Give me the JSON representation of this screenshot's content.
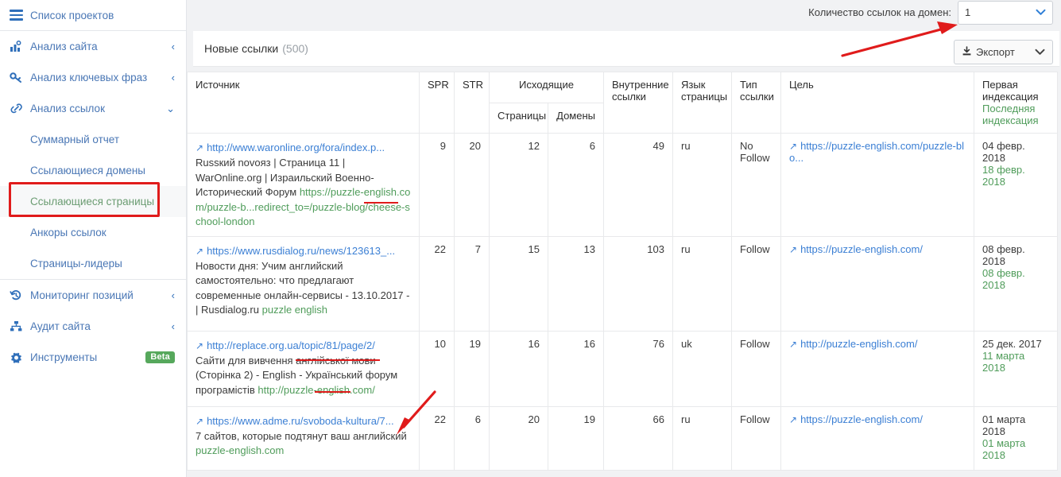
{
  "sidebar": {
    "header": {
      "label": "Список проектов",
      "icon": "hamburger-icon"
    },
    "items": [
      {
        "label": "Анализ сайта",
        "icon": "site-analysis-icon",
        "chevron": "‹"
      },
      {
        "label": "Анализ ключевых фраз",
        "icon": "key-icon",
        "chevron": "‹"
      },
      {
        "label": "Анализ ссылок",
        "icon": "link-icon",
        "chevron": "⌄"
      }
    ],
    "sub_items": [
      {
        "label": "Суммарный отчет",
        "active": false
      },
      {
        "label": "Ссылающиеся домены",
        "active": false
      },
      {
        "label": "Ссылающиеся страницы",
        "active": true
      },
      {
        "label": "Анкоры ссылок",
        "active": false
      },
      {
        "label": "Страницы-лидеры",
        "active": false
      }
    ],
    "bottom_items": [
      {
        "label": "Мониторинг позиций",
        "icon": "history-icon",
        "chevron": "‹",
        "badge": ""
      },
      {
        "label": "Аудит сайта",
        "icon": "sitemap-icon",
        "chevron": "‹",
        "badge": ""
      },
      {
        "label": "Инструменты",
        "icon": "gear-icon",
        "chevron": "",
        "badge": "Beta"
      }
    ]
  },
  "topbar": {
    "links_per_domain_label": "Количество ссылок на домен:",
    "links_per_domain_value": "1",
    "export_label": "Экспорт",
    "export_icon": "download-icon",
    "caret_icon": "chevron-down-icon"
  },
  "panel": {
    "title": "Новые ссылки",
    "count": "(500)"
  },
  "table": {
    "columns": [
      {
        "key": "source",
        "label": "Источник"
      },
      {
        "key": "spr",
        "label": "SPR"
      },
      {
        "key": "str",
        "label": "STR"
      },
      {
        "key": "outgoing",
        "label": "Исходящие",
        "sub": [
          "Страницы",
          "Домены"
        ]
      },
      {
        "key": "internal",
        "label": "Внутренние ссылки"
      },
      {
        "key": "lang",
        "label": "Язык страницы"
      },
      {
        "key": "linktype",
        "label": "Тип ссылки"
      },
      {
        "key": "target",
        "label": "Цель"
      },
      {
        "key": "indexation",
        "label_first": "Первая индексация",
        "label_last": "Последняя индексация"
      }
    ],
    "rows": [
      {
        "source_url": "http://www.waronline.org/fora/index.p...",
        "source_desc": "Russкий novoяз | Страница 11 | WarOnline.org | Израильский Военно-Исторический Форум",
        "source_extra": "https://puzzle-english.com/puzzle-b...redirect_to=/puzzle-blog/cheese-school-london",
        "spr": "9",
        "str": "20",
        "out_pages": "12",
        "out_domains": "6",
        "internal": "49",
        "lang": "ru",
        "linktype": "No Follow",
        "target": "https://puzzle-english.com/puzzle-blo...",
        "first_index": "04 февр. 2018",
        "last_index": "18 февр. 2018"
      },
      {
        "source_url": "https://www.rusdialog.ru/news/123613_...",
        "source_desc": "Новости дня: Учим английский самостоятельно: что предлагают современные онлайн-сервисы - 13.10.2017 - | Rusdialog.ru",
        "source_extra": "puzzle english",
        "spr": "22",
        "str": "7",
        "out_pages": "15",
        "out_domains": "13",
        "internal": "103",
        "lang": "ru",
        "linktype": "Follow",
        "target": "https://puzzle-english.com/",
        "first_index": "08 февр. 2018",
        "last_index": "08 февр. 2018"
      },
      {
        "source_url": "http://replace.org.ua/topic/81/page/2/",
        "source_desc": "Сайти для вивчення англійської мови (Сторінка 2) - English - Український форум програмістів",
        "source_extra": "http://puzzle-english.com/",
        "spr": "10",
        "str": "19",
        "out_pages": "16",
        "out_domains": "16",
        "internal": "76",
        "lang": "uk",
        "linktype": "Follow",
        "target": "http://puzzle-english.com/",
        "first_index": "25 дек. 2017",
        "last_index": "11 марта 2018"
      },
      {
        "source_url": "https://www.adme.ru/svoboda-kultura/7...",
        "source_desc": "7 сайтов, которые подтянут ваш английский",
        "source_extra": "puzzle-english.com",
        "spr": "22",
        "str": "6",
        "out_pages": "20",
        "out_domains": "19",
        "internal": "66",
        "lang": "ru",
        "linktype": "Follow",
        "target": "https://puzzle-english.com/",
        "first_index": "01 марта 2018",
        "last_index": "01 марта 2018"
      }
    ]
  },
  "colors": {
    "accent_blue": "#3b7fd4",
    "green": "#4f9c5a",
    "annotation_red": "#e01b1b",
    "sidebar_text": "#4a77b5"
  }
}
